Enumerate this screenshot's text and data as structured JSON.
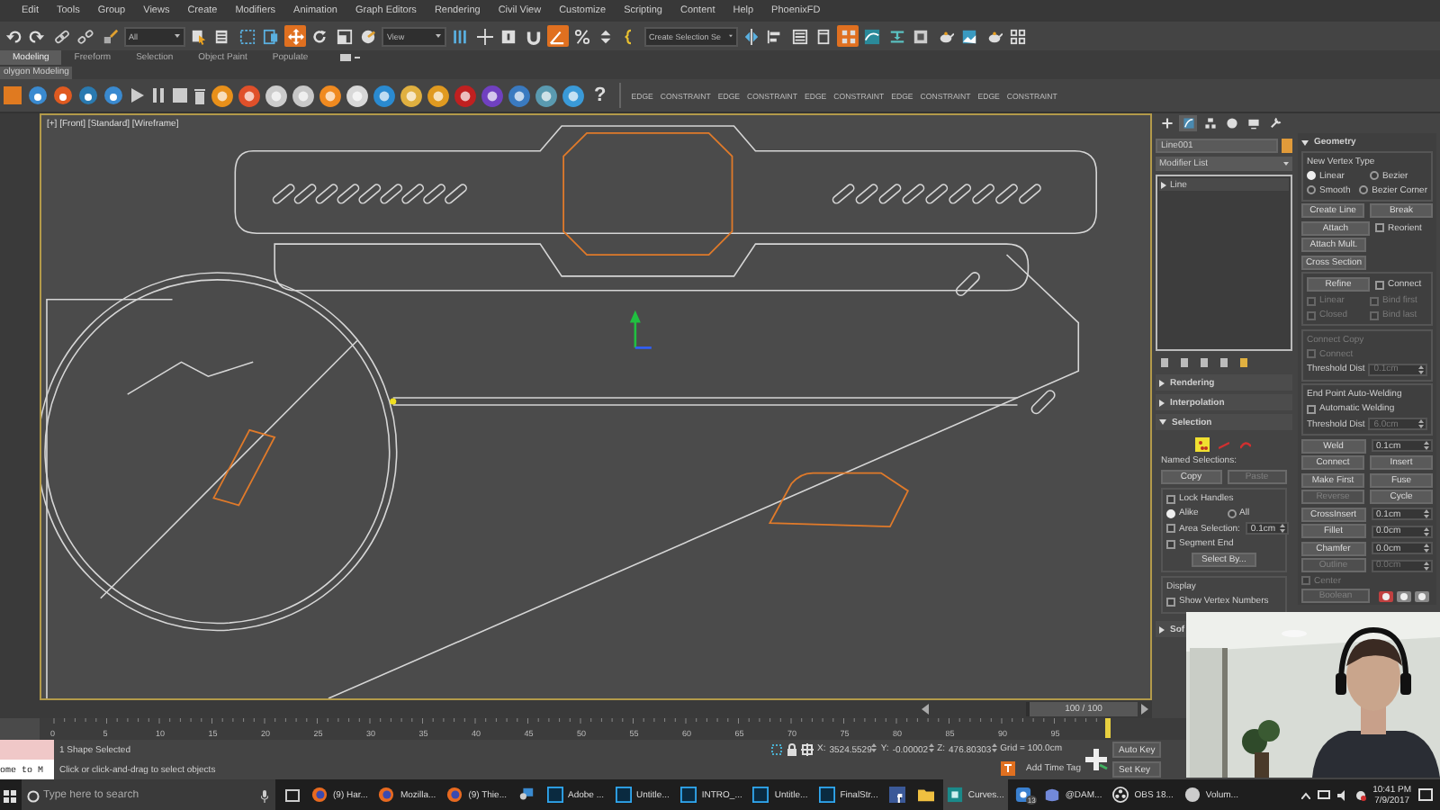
{
  "menu_bar": {
    "items": [
      "Edit",
      "Tools",
      "Group",
      "Views",
      "Create",
      "Modifiers",
      "Animation",
      "Graph Editors",
      "Rendering",
      "Civil View",
      "Customize",
      "Scripting",
      "Content",
      "Help",
      "PhoenixFD"
    ]
  },
  "main_toolbar": [
    {
      "kind": "undo",
      "selected": false
    },
    {
      "kind": "redo",
      "selected": false
    },
    {
      "kind": "link",
      "selected": false
    },
    {
      "kind": "unlink",
      "selected": false
    },
    {
      "kind": "bind",
      "selected": false
    },
    {
      "kind": "dropdown",
      "value": "All"
    },
    {
      "kind": "select",
      "selected": false
    },
    {
      "kind": "list",
      "selected": false
    },
    {
      "kind": "region",
      "selected": false
    },
    {
      "kind": "window",
      "selected": false
    },
    {
      "kind": "move",
      "selected": true
    },
    {
      "kind": "rotate",
      "selected": false
    },
    {
      "kind": "scale",
      "selected": false
    },
    {
      "kind": "place",
      "selected": false
    },
    {
      "kind": "dropdown",
      "value": "View"
    },
    {
      "kind": "pivot",
      "selected": false
    },
    {
      "kind": "manip",
      "selected": false
    },
    {
      "kind": "key",
      "selected": false
    },
    {
      "kind": "snap",
      "selected": false
    },
    {
      "kind": "angle",
      "selected": true
    },
    {
      "kind": "percent",
      "selected": false
    },
    {
      "kind": "spinner",
      "selected": false
    },
    {
      "kind": "brace",
      "selected": false
    },
    {
      "kind": "dropdown",
      "value": "Create Selection Se"
    },
    {
      "kind": "mirror",
      "selected": false
    },
    {
      "kind": "align",
      "selected": false
    },
    {
      "kind": "layer",
      "selected": false
    },
    {
      "kind": "panel",
      "selected": false
    },
    {
      "kind": "schematic",
      "selected": true
    },
    {
      "kind": "curve",
      "selected": false
    },
    {
      "kind": "bar",
      "selected": false
    },
    {
      "kind": "render",
      "selected": false
    },
    {
      "kind": "teapot",
      "selected": false
    },
    {
      "kind": "frame",
      "selected": false
    },
    {
      "kind": "teapot",
      "selected": false
    },
    {
      "kind": "grid",
      "selected": false
    }
  ],
  "ribbon": {
    "tabs": [
      {
        "label": "Modeling",
        "selected": true
      },
      {
        "label": "Freeform",
        "selected": false
      },
      {
        "label": "Selection",
        "selected": false
      },
      {
        "label": "Object Paint",
        "selected": false
      },
      {
        "label": "Populate",
        "selected": false
      }
    ],
    "panel_label": "olygon Modeling"
  },
  "phoenix_toolbar": {
    "help": "?",
    "labels": [
      "EDGE",
      "CONSTRAINT",
      "EDGE",
      "CONSTRAINT",
      "EDGE",
      "CONSTRAINT",
      "EDGE",
      "CONSTRAINT",
      "EDGE",
      "CONSTRAINT"
    ]
  },
  "viewport": {
    "label": "[+] [Front] [Standard] [Wireframe]"
  },
  "time_slider": {
    "label": "100 / 100",
    "level": 1
  },
  "command_panel": {
    "tabs": [
      {
        "kind": "create",
        "selected": false
      },
      {
        "kind": "modify",
        "selected": true
      },
      {
        "kind": "hierarchy",
        "selected": false
      },
      {
        "kind": "motion",
        "selected": false
      },
      {
        "kind": "display",
        "selected": false
      },
      {
        "kind": "utilities",
        "selected": false
      }
    ],
    "object_name": "Line001",
    "modifier_list": "Modifier List",
    "stack": [
      "Line"
    ],
    "rollouts": [
      {
        "kind": "rendering",
        "title": "Rendering",
        "expanded": false
      },
      {
        "kind": "interpolation",
        "title": "Interpolation",
        "expanded": false
      },
      {
        "kind": "selection",
        "title": "Selection",
        "expanded": true
      },
      {
        "kind": "soft_selection",
        "title": "Sof",
        "expanded": false
      }
    ],
    "selection": {
      "levels": [
        {
          "kind": "vertex",
          "selected": true
        },
        {
          "kind": "segment",
          "selected": false
        },
        {
          "kind": "spline",
          "selected": false
        }
      ],
      "named_label": "Named Selections:",
      "copy": {
        "label": "Copy",
        "disabled": false
      },
      "paste": {
        "label": "Paste",
        "disabled": true
      },
      "lock_handles": {
        "label": "Lock Handles",
        "checked": false
      },
      "handle_modes": [
        {
          "label": "Alike",
          "selected": true
        },
        {
          "label": "All",
          "selected": false
        }
      ],
      "area_selection": {
        "label": "Area Selection:",
        "checked": false,
        "value": "0.1cm"
      },
      "segment_end": {
        "label": "Segment End",
        "checked": false
      },
      "select_by": "Select By...",
      "display_label": "Display",
      "show_vertex_numbers": {
        "label": "Show Vertex Numbers",
        "checked": false
      }
    },
    "geometry": {
      "title": "Geometry",
      "expanded": true,
      "vertex_type_label": "New Vertex Type",
      "vertex_types": [
        {
          "label": "Linear",
          "selected": true
        },
        {
          "label": "Bezier",
          "selected": false
        },
        {
          "label": "Smooth",
          "selected": false
        },
        {
          "label": "Bezier Corner",
          "selected": false
        }
      ],
      "rows": [
        {
          "kind": "row",
          "items": [
            {
              "kind": "button",
              "label": "Create Line",
              "disabled": false
            },
            {
              "kind": "button",
              "label": "Break",
              "disabled": false
            }
          ]
        },
        {
          "kind": "row",
          "items": [
            {
              "kind": "button",
              "label": "Attach",
              "disabled": false
            },
            {
              "kind": "checkbox",
              "label": "Reorient",
              "checked": false,
              "disabled": false
            }
          ]
        },
        {
          "kind": "row",
          "items": [
            {
              "kind": "button",
              "label": "Attach Mult.",
              "disabled": false
            }
          ]
        },
        {
          "kind": "row",
          "items": [
            {
              "kind": "button",
              "label": "Cross Section",
              "disabled": false
            }
          ]
        },
        {
          "kind": "group",
          "rows": [
            {
              "kind": "row",
              "items": [
                {
                  "kind": "button",
                  "label": "Refine",
                  "disabled": false
                },
                {
                  "kind": "checkbox",
                  "label": "Connect",
                  "checked": false,
                  "disabled": false
                }
              ]
            },
            {
              "kind": "row",
              "items": [
                {
                  "kind": "checkbox",
                  "label": "Linear",
                  "checked": false,
                  "disabled": true
                },
                {
                  "kind": "checkbox",
                  "label": "Bind first",
                  "checked": false,
                  "disabled": true
                }
              ]
            },
            {
              "kind": "row",
              "items": [
                {
                  "kind": "checkbox",
                  "label": "Closed",
                  "checked": false,
                  "disabled": true
                },
                {
                  "kind": "checkbox",
                  "label": "Bind last",
                  "checked": false,
                  "disabled": true
                }
              ]
            }
          ]
        },
        {
          "kind": "group",
          "title": "Connect Copy",
          "disabled": true,
          "rows": [
            {
              "kind": "row",
              "items": [
                {
                  "kind": "checkbox",
                  "label": "Connect",
                  "checked": false,
                  "disabled": true
                }
              ]
            },
            {
              "kind": "row",
              "items": [
                {
                  "kind": "spinner",
                  "label": "Threshold Dist",
                  "value": "0.1cm",
                  "disabled": true
                }
              ]
            }
          ]
        },
        {
          "kind": "group",
          "title": "End Point Auto-Welding",
          "disabled": false,
          "rows": [
            {
              "kind": "row",
              "items": [
                {
                  "kind": "checkbox",
                  "label": "Automatic Welding",
                  "checked": false,
                  "disabled": false
                }
              ]
            },
            {
              "kind": "row",
              "items": [
                {
                  "kind": "spinner",
                  "label": "Threshold Dist",
                  "value": "6.0cm",
                  "disabled": true
                }
              ]
            }
          ]
        },
        {
          "kind": "row",
          "items": [
            {
              "kind": "button",
              "label": "Weld",
              "disabled": false
            },
            {
              "kind": "spinner",
              "value": "0.1cm",
              "disabled": false
            }
          ]
        },
        {
          "kind": "row",
          "items": [
            {
              "kind": "button",
              "label": "Connect",
              "disabled": false
            },
            {
              "kind": "button",
              "label": "Insert",
              "disabled": false
            }
          ]
        },
        {
          "kind": "row",
          "items": [
            {
              "kind": "button",
              "label": "Make First",
              "disabled": false
            },
            {
              "kind": "button",
              "label": "Fuse",
              "disabled": false
            }
          ]
        },
        {
          "kind": "row",
          "items": [
            {
              "kind": "button",
              "label": "Reverse",
              "disabled": true
            },
            {
              "kind": "button",
              "label": "Cycle",
              "disabled": false
            }
          ]
        },
        {
          "kind": "row",
          "items": [
            {
              "kind": "button",
              "label": "CrossInsert",
              "disabled": false
            },
            {
              "kind": "spinner",
              "value": "0.1cm",
              "disabled": false
            }
          ]
        },
        {
          "kind": "row",
          "items": [
            {
              "kind": "button",
              "label": "Fillet",
              "disabled": false
            },
            {
              "kind": "spinner",
              "value": "0.0cm",
              "disabled": false
            }
          ]
        },
        {
          "kind": "row",
          "items": [
            {
              "kind": "button",
              "label": "Chamfer",
              "disabled": false
            },
            {
              "kind": "spinner",
              "value": "0.0cm",
              "disabled": false
            }
          ]
        },
        {
          "kind": "row",
          "items": [
            {
              "kind": "button",
              "label": "Outline",
              "disabled": true
            },
            {
              "kind": "spinner",
              "value": "0.0cm",
              "disabled": true
            }
          ]
        },
        {
          "kind": "row",
          "items": [
            {
              "kind": "checkbox",
              "label": "Center",
              "checked": false,
              "disabled": true
            }
          ]
        },
        {
          "kind": "row",
          "items": [
            {
              "kind": "button",
              "label": "Boolean",
              "disabled": true
            },
            {
              "kind": "boolean_icons"
            }
          ]
        }
      ]
    }
  },
  "track_bar": {
    "ticks": [
      "0",
      "5",
      "10",
      "15",
      "20",
      "25",
      "30",
      "35",
      "40",
      "45",
      "50",
      "55",
      "60",
      "65",
      "70",
      "75",
      "80",
      "85",
      "90",
      "95"
    ]
  },
  "status": {
    "script_output": "ome to M",
    "selection_info": "1 Shape Selected",
    "prompt": "Click or click-and-drag to select objects",
    "coords": [
      {
        "axis": "X:",
        "value": "3524.5529"
      },
      {
        "axis": "Y:",
        "value": "-0.00002"
      },
      {
        "axis": "Z:",
        "value": "476.80303"
      }
    ],
    "grid": "Grid = 100.0cm",
    "time_tag": "Add Time Tag",
    "auto_key": "Auto Key",
    "set_key": "Set Key"
  },
  "taskbar": {
    "search_placeholder": "Type here to search",
    "apps": [
      {
        "kind": "firefox",
        "label": "(9) Har...",
        "active": false
      },
      {
        "kind": "firefox",
        "label": "Mozilla...",
        "active": false
      },
      {
        "kind": "firefox",
        "label": "(9) Thie...",
        "active": false
      },
      {
        "kind": "user",
        "active": false
      },
      {
        "kind": "photoshop",
        "label": "Adobe ...",
        "active": false
      },
      {
        "kind": "photoshop",
        "label": "Untitle...",
        "active": false
      },
      {
        "kind": "photoshop",
        "label": "INTRO_...",
        "active": false
      },
      {
        "kind": "photoshop",
        "label": "Untitle...",
        "active": false
      },
      {
        "kind": "photoshop",
        "label": "FinalStr...",
        "active": false
      },
      {
        "kind": "facebook",
        "active": false
      },
      {
        "kind": "folder",
        "active": false
      },
      {
        "kind": "max",
        "label": "Curves...",
        "active": true
      },
      {
        "kind": "chat",
        "badge": "13",
        "active": false
      },
      {
        "kind": "discord",
        "label": "@DAM...",
        "active": false
      },
      {
        "kind": "obs",
        "label": "OBS 18...",
        "active": false
      },
      {
        "kind": "volume",
        "label": "Volum...",
        "active": false
      }
    ],
    "time": "10:41 PM",
    "date": "7/9/2017"
  }
}
